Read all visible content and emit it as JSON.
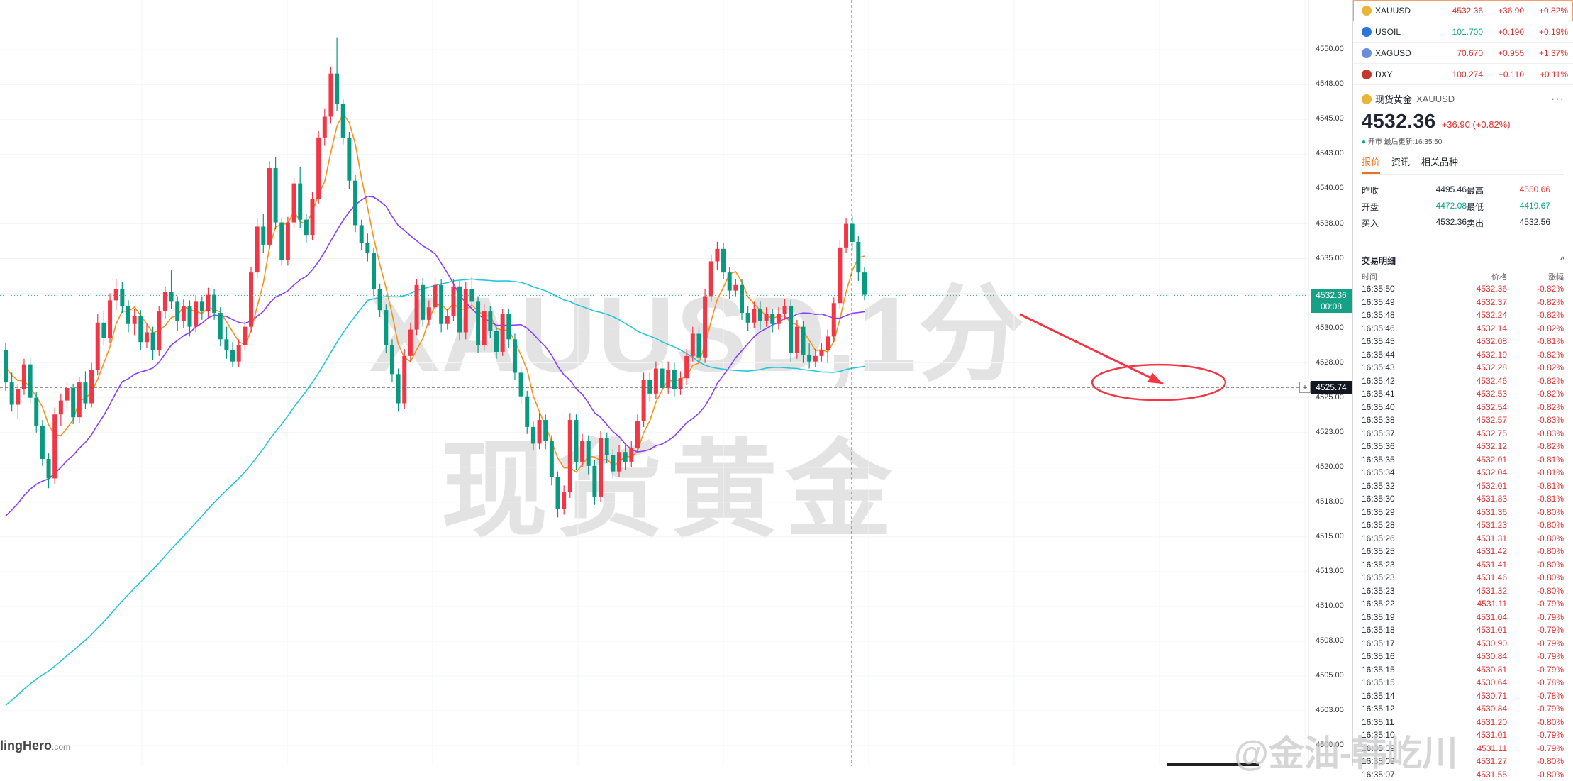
{
  "chart": {
    "watermark_line1": "XAUUSD,1分",
    "watermark_line2": "现货黄金",
    "brand": "lingHero",
    "brand_suffix": ".com",
    "last_price_tag": "4532.36",
    "countdown_tag": "00:08",
    "crosshair_price_tag": "4525.74",
    "colors": {
      "up": "#f23645",
      "down": "#089981",
      "ma_fast": "#f7931a",
      "ma_mid": "#8b3dff",
      "ma_slow": "#26c6da",
      "annotation": "#f23645"
    }
  },
  "chart_data": {
    "type": "candlestick",
    "title": "XAUUSD,1分",
    "ylim": [
      4499.8,
      4551.8
    ],
    "y_ticks": [
      "4550.00",
      "4548.00",
      "4545.00",
      "4543.00",
      "4540.00",
      "4538.00",
      "4535.00",
      "4533.00",
      "4530.00",
      "4528.00",
      "4525.00",
      "4523.00",
      "4520.00",
      "4518.00",
      "4515.00",
      "4513.00",
      "4510.00",
      "4508.00",
      "4505.00",
      "4503.00",
      "4500.00"
    ],
    "y_tick_values": [
      4550,
      4547.5,
      4545,
      4542.5,
      4540,
      4537.5,
      4535,
      4532.5,
      4530,
      4527.5,
      4525,
      4522.5,
      4520,
      4517.5,
      4515,
      4512.5,
      4510,
      4507.5,
      4505,
      4502.5,
      4500
    ],
    "last_price": 4532.36,
    "reference_price": 4525.74,
    "candles": [
      [
        4528.4,
        4528.9,
        4525.5,
        4526.1
      ],
      [
        4526.1,
        4526.8,
        4524.0,
        4524.5
      ],
      [
        4524.5,
        4526.0,
        4523.5,
        4525.6
      ],
      [
        4525.6,
        4527.8,
        4525.2,
        4527.4
      ],
      [
        4527.4,
        4527.9,
        4524.6,
        4525.0
      ],
      [
        4525.0,
        4525.4,
        4522.5,
        4523.0
      ],
      [
        4523.0,
        4523.4,
        4520.1,
        4520.6
      ],
      [
        4520.6,
        4521.0,
        4518.5,
        4519.2
      ],
      [
        4519.2,
        4524.3,
        4518.8,
        4523.8
      ],
      [
        4523.8,
        4525.3,
        4523.0,
        4524.8
      ],
      [
        4524.8,
        4526.1,
        4524.0,
        4525.7
      ],
      [
        4525.7,
        4526.0,
        4523.1,
        4523.6
      ],
      [
        4523.6,
        4526.5,
        4523.2,
        4526.1
      ],
      [
        4526.1,
        4526.9,
        4524.2,
        4524.6
      ],
      [
        4524.6,
        4527.5,
        4524.3,
        4527.0
      ],
      [
        4527.0,
        4531.0,
        4526.6,
        4530.4
      ],
      [
        4530.4,
        4531.2,
        4528.8,
        4529.3
      ],
      [
        4529.3,
        4532.5,
        4528.9,
        4532.0
      ],
      [
        4532.0,
        4533.5,
        4531.3,
        4532.8
      ],
      [
        4532.8,
        4533.3,
        4531.1,
        4531.6
      ],
      [
        4531.6,
        4532.0,
        4529.7,
        4530.3
      ],
      [
        4530.3,
        4531.4,
        4529.5,
        4530.9
      ],
      [
        4530.9,
        4531.3,
        4528.4,
        4529.0
      ],
      [
        4529.0,
        4530.3,
        4528.6,
        4529.7
      ],
      [
        4529.7,
        4530.1,
        4527.7,
        4528.4
      ],
      [
        4528.4,
        4531.6,
        4528.0,
        4531.2
      ],
      [
        4531.2,
        4533.0,
        4530.7,
        4532.6
      ],
      [
        4532.6,
        4534.2,
        4531.4,
        4531.9
      ],
      [
        4531.9,
        4532.3,
        4529.8,
        4530.5
      ],
      [
        4530.5,
        4532.1,
        4530.0,
        4531.6
      ],
      [
        4531.6,
        4532.0,
        4529.4,
        4530.1
      ],
      [
        4530.1,
        4532.4,
        4529.7,
        4531.9
      ],
      [
        4531.9,
        4532.3,
        4530.6,
        4531.2
      ],
      [
        4531.2,
        4532.9,
        4530.8,
        4532.4
      ],
      [
        4532.4,
        4532.8,
        4530.6,
        4531.1
      ],
      [
        4531.1,
        4531.5,
        4528.7,
        4529.2
      ],
      [
        4529.2,
        4530.1,
        4527.8,
        4528.4
      ],
      [
        4528.4,
        4529.0,
        4527.2,
        4527.6
      ],
      [
        4527.6,
        4529.2,
        4527.2,
        4528.8
      ],
      [
        4528.8,
        4530.5,
        4528.4,
        4530.1
      ],
      [
        4530.1,
        4534.4,
        4529.7,
        4534.0
      ],
      [
        4534.0,
        4537.9,
        4533.6,
        4537.3
      ],
      [
        4537.3,
        4538.2,
        4535.4,
        4536.0
      ],
      [
        4536.0,
        4542.0,
        4535.6,
        4541.5
      ],
      [
        4541.5,
        4542.3,
        4537.1,
        4537.6
      ],
      [
        4537.6,
        4537.9,
        4534.5,
        4534.9
      ],
      [
        4534.9,
        4538.0,
        4534.5,
        4537.6
      ],
      [
        4537.6,
        4540.8,
        4537.2,
        4540.4
      ],
      [
        4540.4,
        4541.6,
        4537.2,
        4537.8
      ],
      [
        4537.8,
        4538.2,
        4536.1,
        4536.7
      ],
      [
        4536.7,
        4539.8,
        4536.3,
        4539.3
      ],
      [
        4539.3,
        4544.2,
        4538.9,
        4543.7
      ],
      [
        4543.7,
        4545.8,
        4543.1,
        4545.2
      ],
      [
        4545.2,
        4548.8,
        4544.7,
        4548.3
      ],
      [
        4548.3,
        4550.9,
        4545.6,
        4546.1
      ],
      [
        4546.1,
        4546.5,
        4543.2,
        4543.7
      ],
      [
        4543.7,
        4544.1,
        4540.0,
        4540.6
      ],
      [
        4540.6,
        4541.0,
        4536.9,
        4537.4
      ],
      [
        4537.4,
        4537.8,
        4535.6,
        4536.1
      ],
      [
        4536.1,
        4536.8,
        4534.8,
        4535.4
      ],
      [
        4535.4,
        4535.8,
        4532.3,
        4532.8
      ],
      [
        4532.8,
        4533.2,
        4530.8,
        4531.3
      ],
      [
        4531.3,
        4531.7,
        4528.2,
        4528.8
      ],
      [
        4528.8,
        4529.2,
        4526.1,
        4526.7
      ],
      [
        4526.7,
        4527.1,
        4524.0,
        4524.6
      ],
      [
        4524.6,
        4528.5,
        4524.2,
        4528.0
      ],
      [
        4528.0,
        4530.4,
        4527.6,
        4529.9
      ],
      [
        4529.9,
        4533.5,
        4529.5,
        4533.1
      ],
      [
        4533.1,
        4533.6,
        4530.1,
        4530.6
      ],
      [
        4530.6,
        4532.0,
        4530.2,
        4531.5
      ],
      [
        4531.5,
        4533.7,
        4531.1,
        4533.1
      ],
      [
        4533.1,
        4533.5,
        4529.7,
        4530.3
      ],
      [
        4530.3,
        4531.4,
        4529.9,
        4530.9
      ],
      [
        4530.9,
        4533.5,
        4530.5,
        4533.0
      ],
      [
        4533.0,
        4533.4,
        4529.1,
        4529.7
      ],
      [
        4529.7,
        4533.3,
        4529.2,
        4532.8
      ],
      [
        4532.8,
        4533.7,
        4531.3,
        4531.9
      ],
      [
        4531.9,
        4532.3,
        4528.2,
        4528.8
      ],
      [
        4528.8,
        4531.7,
        4528.4,
        4531.2
      ],
      [
        4531.2,
        4531.6,
        4529.3,
        4529.8
      ],
      [
        4529.8,
        4530.1,
        4527.8,
        4528.3
      ],
      [
        4528.3,
        4531.4,
        4528.0,
        4531.0
      ],
      [
        4531.0,
        4531.4,
        4528.6,
        4529.2
      ],
      [
        4529.2,
        4529.6,
        4526.3,
        4526.8
      ],
      [
        4526.8,
        4527.2,
        4524.5,
        4525.1
      ],
      [
        4525.1,
        4525.5,
        4522.4,
        4522.9
      ],
      [
        4522.9,
        4523.3,
        4521.2,
        4521.7
      ],
      [
        4521.7,
        4523.9,
        4521.3,
        4523.4
      ],
      [
        4523.4,
        4523.8,
        4521.3,
        4521.9
      ],
      [
        4521.9,
        4522.3,
        4518.7,
        4519.3
      ],
      [
        4519.3,
        4519.7,
        4516.4,
        4517.0
      ],
      [
        4517.0,
        4518.7,
        4516.6,
        4518.2
      ],
      [
        4518.2,
        4523.9,
        4517.8,
        4523.4
      ],
      [
        4523.4,
        4523.8,
        4519.8,
        4520.4
      ],
      [
        4520.4,
        4522.4,
        4520.0,
        4521.9
      ],
      [
        4521.9,
        4522.3,
        4519.5,
        4520.1
      ],
      [
        4520.1,
        4520.5,
        4517.3,
        4517.9
      ],
      [
        4517.9,
        4522.6,
        4517.5,
        4522.1
      ],
      [
        4522.1,
        4522.5,
        4520.3,
        4520.9
      ],
      [
        4520.9,
        4521.3,
        4519.2,
        4519.7
      ],
      [
        4519.7,
        4521.6,
        4519.3,
        4521.1
      ],
      [
        4521.1,
        4521.6,
        4519.8,
        4520.4
      ],
      [
        4520.4,
        4521.9,
        4520.0,
        4521.4
      ],
      [
        4521.4,
        4523.8,
        4521.0,
        4523.3
      ],
      [
        4523.3,
        4526.8,
        4522.9,
        4526.3
      ],
      [
        4526.3,
        4526.8,
        4524.7,
        4525.3
      ],
      [
        4525.3,
        4527.6,
        4524.9,
        4527.1
      ],
      [
        4527.1,
        4527.6,
        4525.2,
        4525.7
      ],
      [
        4525.7,
        4527.6,
        4525.3,
        4527.0
      ],
      [
        4527.0,
        4527.5,
        4525.1,
        4525.6
      ],
      [
        4525.6,
        4526.9,
        4525.2,
        4526.4
      ],
      [
        4526.4,
        4528.5,
        4525.9,
        4528.0
      ],
      [
        4528.0,
        4530.1,
        4527.6,
        4529.6
      ],
      [
        4529.6,
        4530.0,
        4527.4,
        4527.9
      ],
      [
        4527.9,
        4532.8,
        4527.5,
        4532.3
      ],
      [
        4532.3,
        4535.3,
        4531.9,
        4534.8
      ],
      [
        4534.8,
        4536.2,
        4534.2,
        4535.7
      ],
      [
        4535.7,
        4536.1,
        4533.5,
        4534.0
      ],
      [
        4534.0,
        4534.4,
        4532.1,
        4532.7
      ],
      [
        4532.7,
        4533.5,
        4532.3,
        4533.1
      ],
      [
        4533.1,
        4533.5,
        4530.6,
        4531.1
      ],
      [
        4531.1,
        4531.6,
        4529.8,
        4530.4
      ],
      [
        4530.4,
        4531.9,
        4530.0,
        4531.4
      ],
      [
        4531.4,
        4531.9,
        4529.9,
        4530.5
      ],
      [
        4530.5,
        4531.5,
        4530.1,
        4531.0
      ],
      [
        4531.0,
        4531.4,
        4529.7,
        4530.3
      ],
      [
        4530.3,
        4531.5,
        4529.9,
        4531.0
      ],
      [
        4531.0,
        4532.1,
        4530.6,
        4531.6
      ],
      [
        4531.6,
        4532.0,
        4527.6,
        4528.2
      ],
      [
        4528.2,
        4530.6,
        4527.8,
        4530.1
      ],
      [
        4530.1,
        4530.5,
        4527.5,
        4528.1
      ],
      [
        4528.1,
        4528.9,
        4527.1,
        4527.6
      ],
      [
        4527.6,
        4528.5,
        4527.2,
        4528.0
      ],
      [
        4528.0,
        4528.9,
        4527.6,
        4528.4
      ],
      [
        4528.4,
        4529.9,
        4527.5,
        4529.4
      ],
      [
        4529.4,
        4532.2,
        4529.0,
        4531.8
      ],
      [
        4531.8,
        4536.3,
        4531.4,
        4535.8
      ],
      [
        4535.8,
        4537.9,
        4535.4,
        4537.5
      ],
      [
        4537.5,
        4538.1,
        4535.6,
        4536.2
      ],
      [
        4536.2,
        4536.6,
        4533.4,
        4534.0
      ],
      [
        4534.0,
        4534.4,
        4532.0,
        4532.4
      ]
    ],
    "series": [
      {
        "name": "",
        "color": "#f7931a"
      },
      {
        "name": "",
        "color": "#8b3dff"
      },
      {
        "name": "",
        "color": "#26c6da"
      }
    ],
    "annotations": [
      "arrow",
      "ellipse"
    ]
  },
  "watchlist": [
    {
      "icon_color": "#e8b43a",
      "symbol": "XAUUSD",
      "price": "4532.36",
      "change": "+36.90",
      "pct": "+0.82%",
      "price_dir": "down",
      "active": true
    },
    {
      "icon_color": "#2a78d6",
      "symbol": "USOIL",
      "price": "101.700",
      "change": "+0.190",
      "pct": "+0.19%",
      "price_dir": "up",
      "active": false
    },
    {
      "icon_color": "#6a8fd8",
      "symbol": "XAGUSD",
      "price": "70.670",
      "change": "+0.955",
      "pct": "+1.37%",
      "price_dir": "down",
      "active": false
    },
    {
      "icon_color": "#c0392b",
      "symbol": "DXY",
      "price": "100.274",
      "change": "+0.110",
      "pct": "+0.11%",
      "price_dir": "down",
      "active": false
    }
  ],
  "detail": {
    "name": "现货黄金",
    "symbol": "XAUUSD",
    "price": "4532.36",
    "change": "+36.90 (+0.82%)",
    "status": "开市  最后更新:16:35:50",
    "more": "···",
    "tabs": [
      "报价",
      "资讯",
      "相关品种"
    ],
    "stats": [
      {
        "label": "昨收",
        "value": "4495.46",
        "label2": "最高",
        "value2": "4550.66"
      },
      {
        "label": "开盘",
        "value": "4472.08",
        "label2": "最低",
        "value2": "4419.67"
      },
      {
        "label": "买入",
        "value": "4532.36",
        "label2": "卖出",
        "value2": "4532.56"
      }
    ]
  },
  "trades": {
    "title": "交易明细",
    "caret": "^",
    "col_time": "时间",
    "col_price": "价格",
    "col_pct": "涨幅",
    "rows": [
      [
        "16:35:50",
        "4532.36",
        "-0.82%"
      ],
      [
        "16:35:49",
        "4532.37",
        "-0.82%"
      ],
      [
        "16:35:48",
        "4532.24",
        "-0.82%"
      ],
      [
        "16:35:46",
        "4532.14",
        "-0.82%"
      ],
      [
        "16:35:45",
        "4532.08",
        "-0.81%"
      ],
      [
        "16:35:44",
        "4532.19",
        "-0.82%"
      ],
      [
        "16:35:43",
        "4532.28",
        "-0.82%"
      ],
      [
        "16:35:42",
        "4532.46",
        "-0.82%"
      ],
      [
        "16:35:41",
        "4532.53",
        "-0.82%"
      ],
      [
        "16:35:40",
        "4532.54",
        "-0.82%"
      ],
      [
        "16:35:38",
        "4532.57",
        "-0.83%"
      ],
      [
        "16:35:37",
        "4532.75",
        "-0.83%"
      ],
      [
        "16:35:36",
        "4532.12",
        "-0.82%"
      ],
      [
        "16:35:35",
        "4532.01",
        "-0.81%"
      ],
      [
        "16:35:34",
        "4532.04",
        "-0.81%"
      ],
      [
        "16:35:32",
        "4532.01",
        "-0.81%"
      ],
      [
        "16:35:30",
        "4531.83",
        "-0.81%"
      ],
      [
        "16:35:29",
        "4531.36",
        "-0.80%"
      ],
      [
        "16:35:28",
        "4531.23",
        "-0.80%"
      ],
      [
        "16:35:26",
        "4531.31",
        "-0.80%"
      ],
      [
        "16:35:25",
        "4531.42",
        "-0.80%"
      ],
      [
        "16:35:23",
        "4531.41",
        "-0.80%"
      ],
      [
        "16:35:23",
        "4531.46",
        "-0.80%"
      ],
      [
        "16:35:23",
        "4531.32",
        "-0.80%"
      ],
      [
        "16:35:22",
        "4531.11",
        "-0.79%"
      ],
      [
        "16:35:19",
        "4531.04",
        "-0.79%"
      ],
      [
        "16:35:18",
        "4531.01",
        "-0.79%"
      ],
      [
        "16:35:17",
        "4530.90",
        "-0.79%"
      ],
      [
        "16:35:16",
        "4530.84",
        "-0.79%"
      ],
      [
        "16:35:15",
        "4530.81",
        "-0.79%"
      ],
      [
        "16:35:15",
        "4530.64",
        "-0.78%"
      ],
      [
        "16:35:14",
        "4530.71",
        "-0.78%"
      ],
      [
        "16:35:12",
        "4530.84",
        "-0.79%"
      ],
      [
        "16:35:11",
        "4531.20",
        "-0.80%"
      ],
      [
        "16:35:10",
        "4531.01",
        "-0.79%"
      ],
      [
        "16:35:09",
        "4531.11",
        "-0.79%"
      ],
      [
        "16:35:09",
        "4531.27",
        "-0.80%"
      ],
      [
        "16:35:07",
        "4531.55",
        "-0.80%"
      ]
    ]
  },
  "overlay": {
    "weibo": "@金油-韩屹川"
  }
}
